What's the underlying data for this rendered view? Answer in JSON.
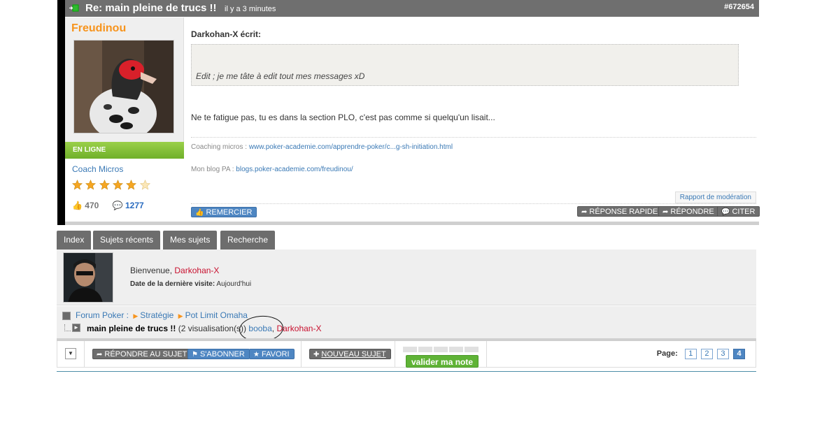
{
  "post": {
    "title": "Re: main pleine de trucs !!",
    "time": "il y a 3 minutes",
    "id": "#672654",
    "author": {
      "name": "Freudinou",
      "status": "EN LIGNE",
      "role": "Coach Micros",
      "stars": 5.5,
      "likes": "470",
      "comments": "1277"
    },
    "quote_author": "Darkohan-X écrit:",
    "quote_text": "Edit ; je me tâte à edit tout mes messages xD",
    "text": "Ne te fatigue pas, tu es dans la section PLO, c'est pas comme si quelqu'un lisait...",
    "signature": {
      "coaching_label": "Coaching micros : ",
      "coaching_link": "www.poker-academie.com/apprendre-poker/c...g-sh-initiation.html",
      "blog_label": "Mon blog PA : ",
      "blog_link": "blogs.poker-academie.com/freudinou/"
    },
    "report": "Rapport de modération",
    "thank_button": "REMERCIER",
    "quick_reply": "RÉPONSE RAPIDE",
    "reply": "RÉPONDRE",
    "quote": "CITER"
  },
  "tabs": [
    "Index",
    "Sujets récents",
    "Mes sujets",
    "Recherche"
  ],
  "welcome": {
    "greeting": "Bienvenue, ",
    "user": "Darkohan-X",
    "last_visit_label": "Date de la dernière visite:",
    "last_visit_value": " Aujourd'hui"
  },
  "breadcrumb": {
    "forum": "Forum Poker :",
    "strategy": "Stratégie",
    "plo": "Pot Limit Omaha",
    "topic": "main pleine de trucs !!",
    "views": " (2 visualisation(s)) ",
    "viewer1": "booba",
    "sep": ", ",
    "viewer2": "Darkohan-X"
  },
  "toolbar": {
    "reply_topic": "RÉPONDRE AU SUJET",
    "subscribe": "S'ABONNER",
    "favorite": "FAVORI",
    "new_topic": "NOUVEAU SUJET",
    "validate": "valider ma note",
    "page_label": "Page:",
    "pages": [
      "1",
      "2",
      "3",
      "4"
    ],
    "current_page": "4"
  },
  "colors": {
    "accent_orange": "#f7941d",
    "link_blue": "#3a79b5",
    "user_red": "#c8102e",
    "online_green": "#6fb02a"
  }
}
